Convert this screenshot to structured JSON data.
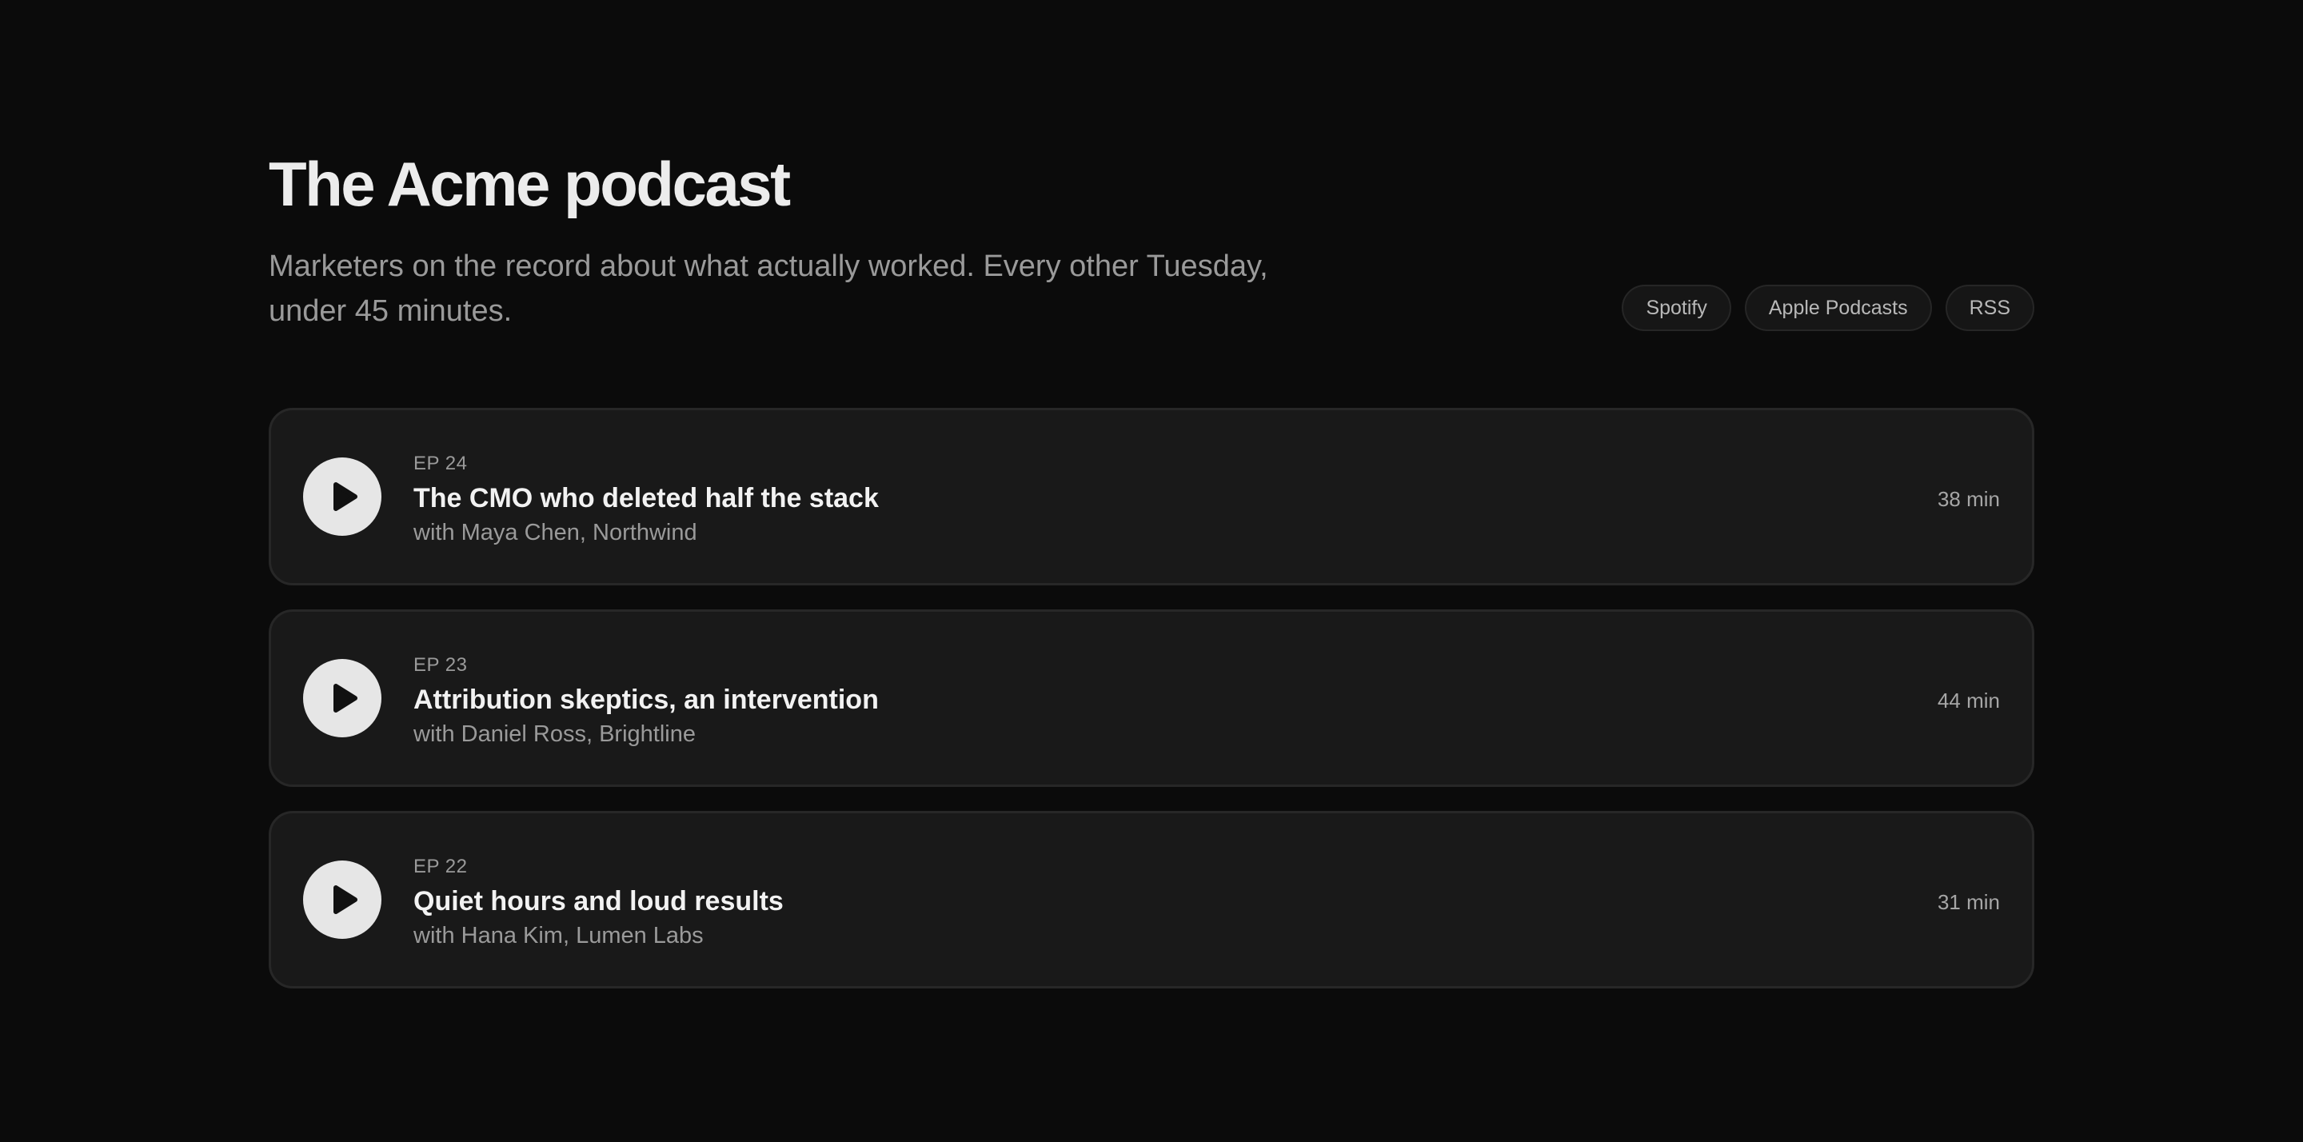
{
  "header": {
    "title": "The Acme podcast",
    "subtitle": "Marketers on the record about what actually worked. Every other Tuesday, under 45 minutes."
  },
  "links": [
    {
      "label": "Spotify"
    },
    {
      "label": "Apple Podcasts"
    },
    {
      "label": "RSS"
    }
  ],
  "episodes": [
    {
      "number": "EP 24",
      "title": "The CMO who deleted half the stack",
      "guest": "with Maya Chen, Northwind",
      "duration": "38 min",
      "icon": "play-icon"
    },
    {
      "number": "EP 23",
      "title": "Attribution skeptics, an intervention",
      "guest": "with Daniel Ross, Brightline",
      "duration": "44 min",
      "icon": "play-icon"
    },
    {
      "number": "EP 22",
      "title": "Quiet hours and loud results",
      "guest": "with Hana Kim, Lumen Labs",
      "duration": "31 min",
      "icon": "play-icon"
    }
  ],
  "colors": {
    "background": "#0b0b0b",
    "card": "#191919",
    "card_border": "#272727",
    "play_button": "#e6e6e6",
    "title_text": "#ececec",
    "muted_text": "#9a9a9a"
  }
}
